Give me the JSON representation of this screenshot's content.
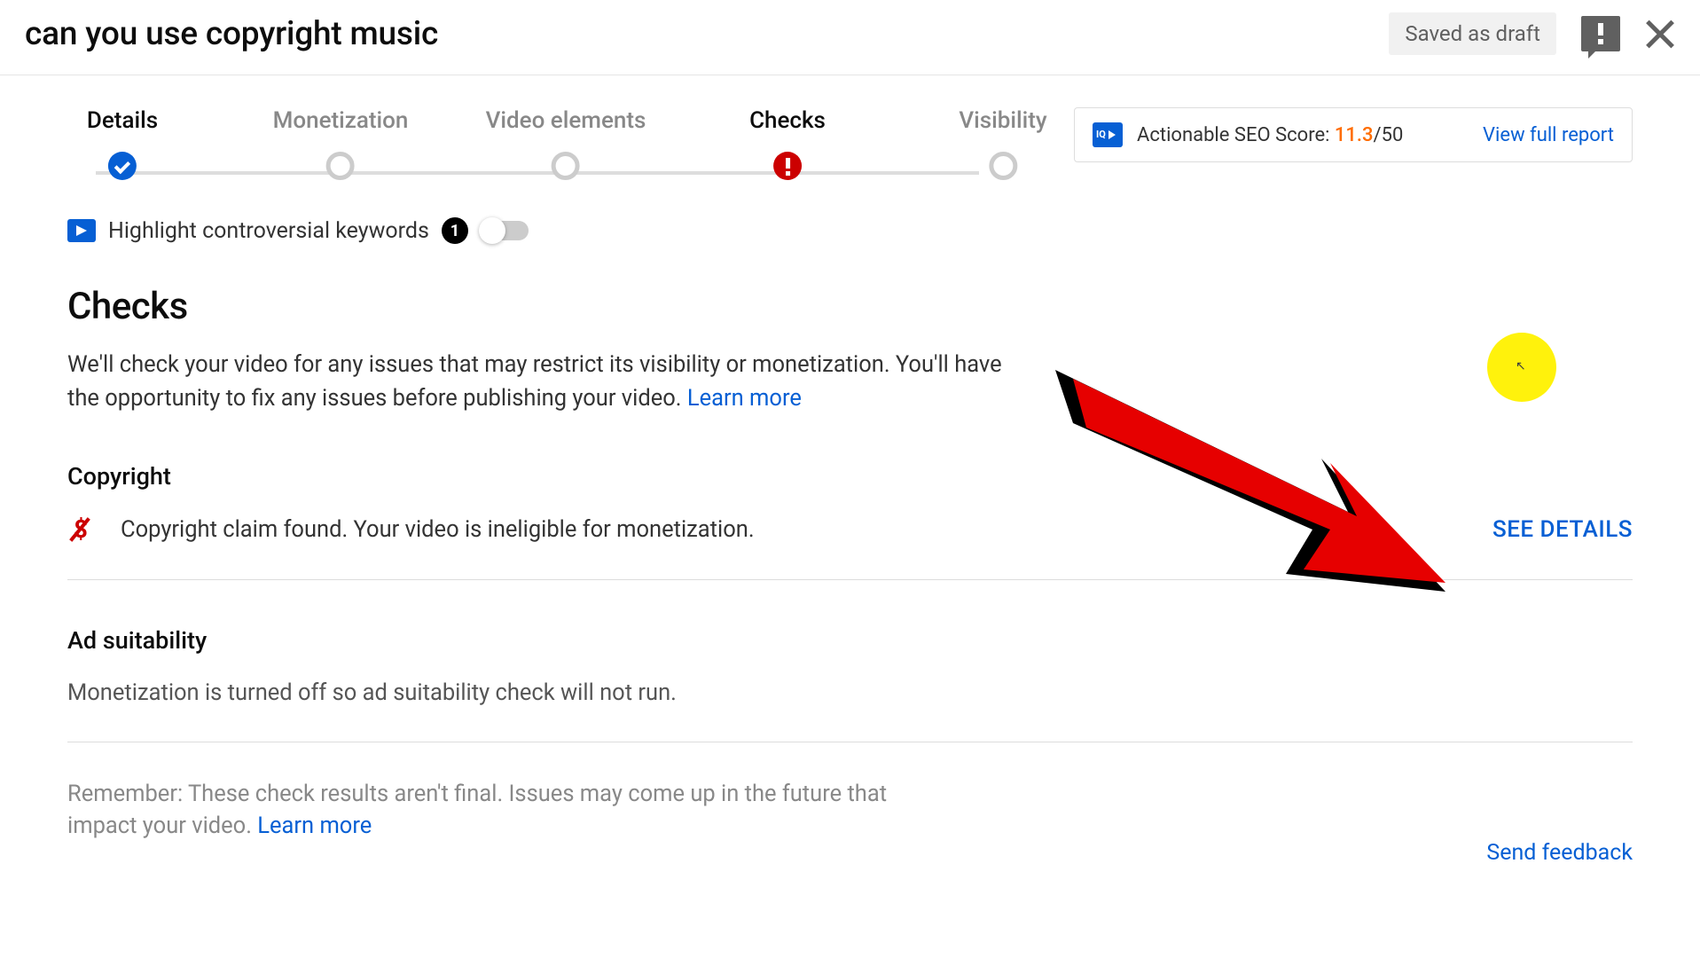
{
  "header": {
    "title": "can you use copyright music",
    "saved_badge": "Saved as draft"
  },
  "stepper": {
    "steps": [
      {
        "label": "Details",
        "state": "done"
      },
      {
        "label": "Monetization",
        "state": "pending"
      },
      {
        "label": "Video elements",
        "state": "pending"
      },
      {
        "label": "Checks",
        "state": "error"
      },
      {
        "label": "Visibility",
        "state": "pending"
      }
    ]
  },
  "seo_card": {
    "label": "Actionable SEO Score: ",
    "score": "11.3",
    "max": "/50",
    "link": "View full report"
  },
  "keyword_toggle": {
    "label": "Highlight controversial keywords",
    "count": "1"
  },
  "checks": {
    "title": "Checks",
    "description": "We'll check your video for any issues that may restrict its visibility or monetization. You'll have the opportunity to fix any issues before publishing your video. ",
    "learn_more": "Learn more"
  },
  "copyright": {
    "title": "Copyright",
    "message": "Copyright claim found. Your video is ineligible for monetization.",
    "action": "SEE DETAILS"
  },
  "ad_suitability": {
    "title": "Ad suitability",
    "message": "Monetization is turned off so ad suitability check will not run."
  },
  "note": {
    "text": "Remember: These check results aren't final. Issues may come up in the future that impact your video. ",
    "learn_more": "Learn more"
  },
  "footer": {
    "send_feedback": "Send feedback"
  }
}
